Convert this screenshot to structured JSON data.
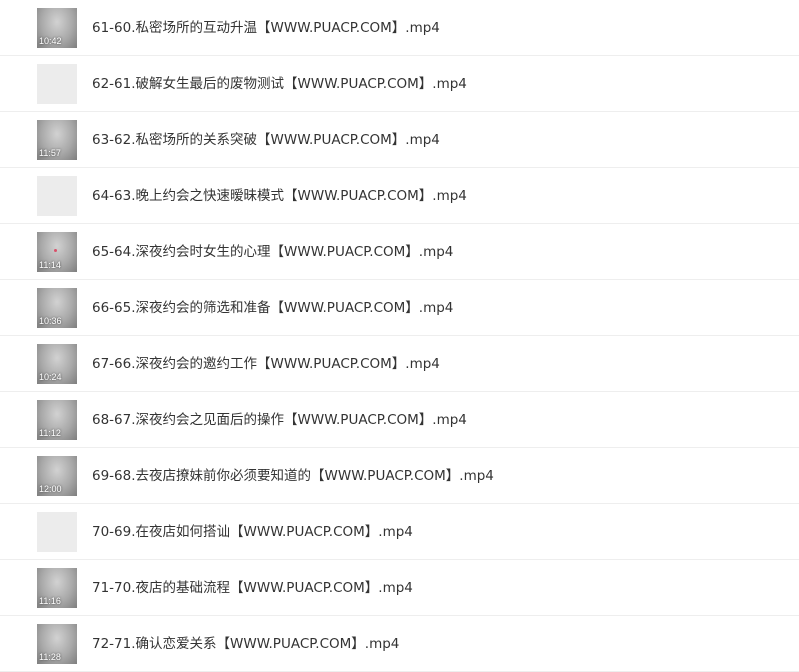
{
  "files": [
    {
      "name": "61-60.私密场所的互动升温【WWW.PUACP.COM】.mp4",
      "duration": "10:42",
      "thumbnail": "video"
    },
    {
      "name": "62-61.破解女生最后的废物测试【WWW.PUACP.COM】.mp4",
      "duration": "",
      "thumbnail": "blank"
    },
    {
      "name": "63-62.私密场所的关系突破【WWW.PUACP.COM】.mp4",
      "duration": "11:57",
      "thumbnail": "video"
    },
    {
      "name": "64-63.晚上约会之快速暧昧模式【WWW.PUACP.COM】.mp4",
      "duration": "",
      "thumbnail": "blank"
    },
    {
      "name": "65-64.深夜约会时女生的心理【WWW.PUACP.COM】.mp4",
      "duration": "11:14",
      "thumbnail": "video"
    },
    {
      "name": "66-65.深夜约会的筛选和准备【WWW.PUACP.COM】.mp4",
      "duration": "10:36",
      "thumbnail": "video"
    },
    {
      "name": "67-66.深夜约会的邀约工作【WWW.PUACP.COM】.mp4",
      "duration": "10:24",
      "thumbnail": "video"
    },
    {
      "name": "68-67.深夜约会之见面后的操作【WWW.PUACP.COM】.mp4",
      "duration": "11:12",
      "thumbnail": "video"
    },
    {
      "name": "69-68.去夜店撩妹前你必须要知道的【WWW.PUACP.COM】.mp4",
      "duration": "12:00",
      "thumbnail": "video"
    },
    {
      "name": "70-69.在夜店如何搭讪【WWW.PUACP.COM】.mp4",
      "duration": "",
      "thumbnail": "blank"
    },
    {
      "name": "71-70.夜店的基础流程【WWW.PUACP.COM】.mp4",
      "duration": "11:16",
      "thumbnail": "video"
    },
    {
      "name": "72-71.确认恋爱关系【WWW.PUACP.COM】.mp4",
      "duration": "11:28",
      "thumbnail": "video"
    }
  ]
}
